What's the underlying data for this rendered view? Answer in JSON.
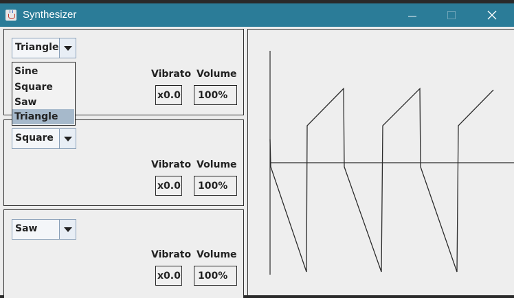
{
  "window": {
    "title": "Synthesizer",
    "titlebar_color": "#2b7c98"
  },
  "oscillators": [
    {
      "waveform": "Triangle",
      "vibrato_label": "Vibrato",
      "volume_label": "Volume",
      "vibrato_value": "x0.0",
      "volume_value": "100%"
    },
    {
      "waveform": "Square",
      "vibrato_label": "Vibrato",
      "volume_label": "Volume",
      "vibrato_value": "x0.0",
      "volume_value": "100%"
    },
    {
      "waveform": "Saw",
      "vibrato_label": "Vibrato",
      "volume_label": "Volume",
      "vibrato_value": "x0.0",
      "volume_value": "100%"
    }
  ],
  "dropdown": {
    "options": [
      "Sine",
      "Square",
      "Saw",
      "Triangle"
    ],
    "highlighted": "Triangle",
    "highlight_color": "#a6b9cb"
  },
  "icons": {
    "app": "java-cup-icon",
    "minimize": "minimize-icon",
    "maximize": "maximize-icon",
    "close": "close-icon",
    "combo_arrow": "chevron-down-icon"
  }
}
